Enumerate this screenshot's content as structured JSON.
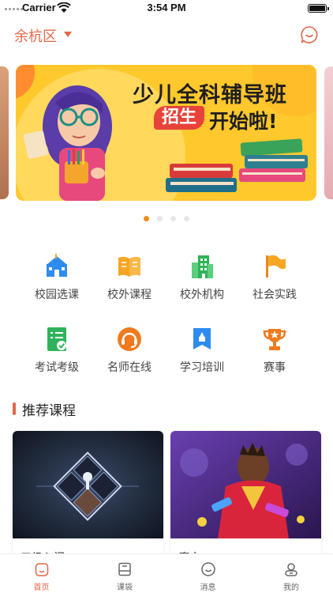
{
  "status_bar": {
    "carrier": "Carrier",
    "time": "3:54 PM"
  },
  "header": {
    "location": "余杭区",
    "message_icon": "chat-bubble-icon"
  },
  "banner": {
    "title": "少儿全科辅导班",
    "tag": "招生",
    "subtitle": "开始啦!",
    "slide_count": 4,
    "active_slide": 1
  },
  "categories": [
    {
      "label": "校园选课",
      "icon": "school-icon",
      "color": "#2d8cf0"
    },
    {
      "label": "校外课程",
      "icon": "book-icon",
      "color": "#f5a623"
    },
    {
      "label": "校外机构",
      "icon": "building-icon",
      "color": "#2fb35a"
    },
    {
      "label": "社会实践",
      "icon": "flag-icon",
      "color": "#f5a623"
    },
    {
      "label": "考试考级",
      "icon": "checklist-icon",
      "color": "#2fb35a"
    },
    {
      "label": "名师在线",
      "icon": "headset-icon",
      "color": "#f07a1e"
    },
    {
      "label": "学习培训",
      "icon": "bookmark-icon",
      "color": "#2d8cf0"
    },
    {
      "label": "赛事",
      "icon": "trophy-icon",
      "color": "#f07a1e"
    }
  ],
  "recommended": {
    "title": "推荐课程",
    "cards": [
      {
        "title": "三级入门"
      },
      {
        "title": "魔方"
      }
    ]
  },
  "tabbar": [
    {
      "label": "首页",
      "icon": "home-icon",
      "active": true
    },
    {
      "label": "课袋",
      "icon": "course-bag-icon",
      "active": false
    },
    {
      "label": "消息",
      "icon": "message-icon",
      "active": false
    },
    {
      "label": "我的",
      "icon": "profile-icon",
      "active": false
    }
  ],
  "colors": {
    "accent": "#e0674a",
    "banner_yellow": "#ffc82c",
    "dot_active": "#f08a1c"
  }
}
